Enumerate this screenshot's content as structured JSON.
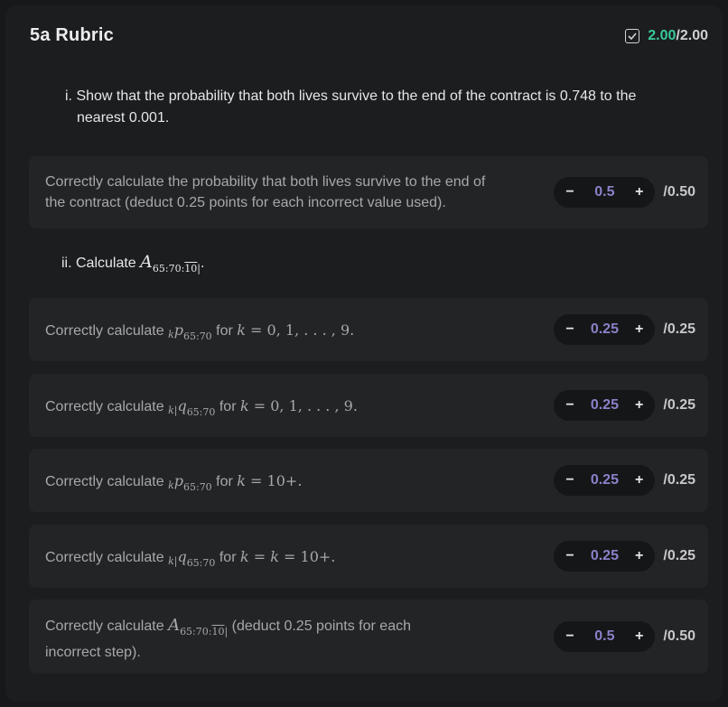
{
  "header": {
    "title": "5a Rubric",
    "score_got": "2.00",
    "score_sep": "/",
    "score_max": "2.00"
  },
  "questions": {
    "q1_line1": "i. Show that the probability that both lives survive to the end of the contract is 0.748 to the",
    "q1_line2": "nearest 0.001.",
    "q2_prefix": "ii. Calculate"
  },
  "items": [
    {
      "line1": "Correctly calculate the probability that both lives survive to the end of",
      "line2": "the contract (deduct 0.25 points for each incorrect value used).",
      "value": "0.5",
      "max": "/0.50"
    },
    {
      "text_prefix": "Correctly calculate",
      "text_mid": "for",
      "value": "0.25",
      "max": "/0.25"
    },
    {
      "text_prefix": "Correctly calculate",
      "text_mid": "for",
      "value": "0.25",
      "max": "/0.25"
    },
    {
      "text_prefix": "Correctly calculate",
      "text_mid": "for",
      "value": "0.25",
      "max": "/0.25"
    },
    {
      "text_prefix": "Correctly calculate",
      "text_mid": "for",
      "value": "0.25",
      "max": "/0.25"
    },
    {
      "line1_prefix": "Correctly calculate",
      "line1_suffix": "(deduct 0.25 points for each",
      "line2": "incorrect step).",
      "value": "0.5",
      "max": "/0.50"
    }
  ],
  "controls": {
    "minus": "−",
    "plus": "+"
  },
  "icons": {
    "score": "checkbox-checked-icon"
  },
  "colors": {
    "score_accent": "#37c99a",
    "value_accent": "#8b80c9"
  }
}
